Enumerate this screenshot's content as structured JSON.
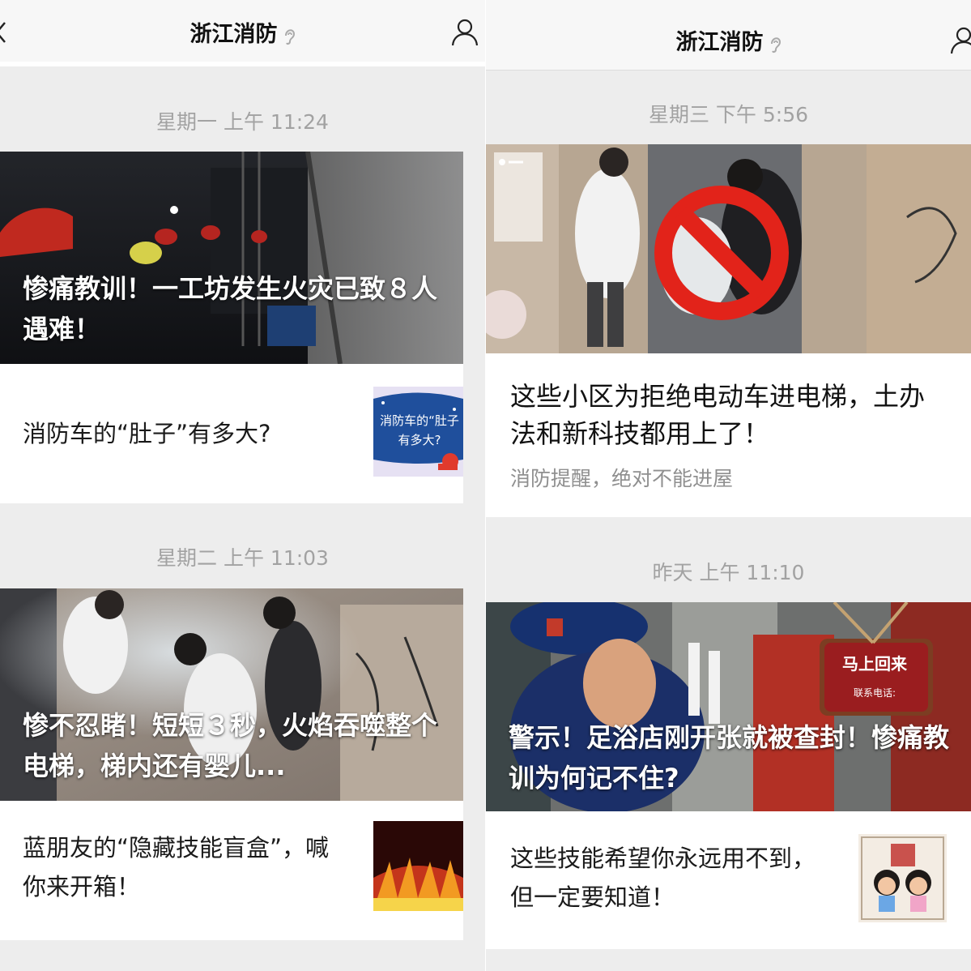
{
  "left": {
    "nav_title": "浙江消防",
    "timestamp_1": "星期一 上午 11:24",
    "card1_cover_title": "惨痛教训！一工坊发生火灾已致８人遇难！",
    "card1_sub": "消防车的“肚子”有多大?",
    "card1_thumb_text": "消防车的“肚子 有多大?",
    "timestamp_2": "星期二 上午 11:03",
    "card2_cover_title": "惨不忍睹！短短３秒，火焰吞噬整个电梯，梯内还有婴儿...",
    "card2_sub": "蓝朋友的“隐藏技能盲盒”，喊你来开箱！"
  },
  "right": {
    "nav_title": "浙江消防",
    "timestamp_1": "星期三 下午 5:56",
    "card1_title": "这些小区为拒绝电动车进电梯，土办法和新科技都用上了！",
    "card1_digest": "消防提醒，绝对不能进屋",
    "timestamp_2": "昨天 上午 11:10",
    "card2_cover_title": "警示！足浴店刚开张就被查封！惨痛教训为何记不住?",
    "card2_sub": "这些技能希望你永远用不到，但一定要知道！",
    "sign_text": "马上回来",
    "sign_small": "联系电话:"
  },
  "icons": [
    "back-arrow-icon",
    "ear-icon",
    "user-profile-icon",
    "no-entry-icon"
  ]
}
